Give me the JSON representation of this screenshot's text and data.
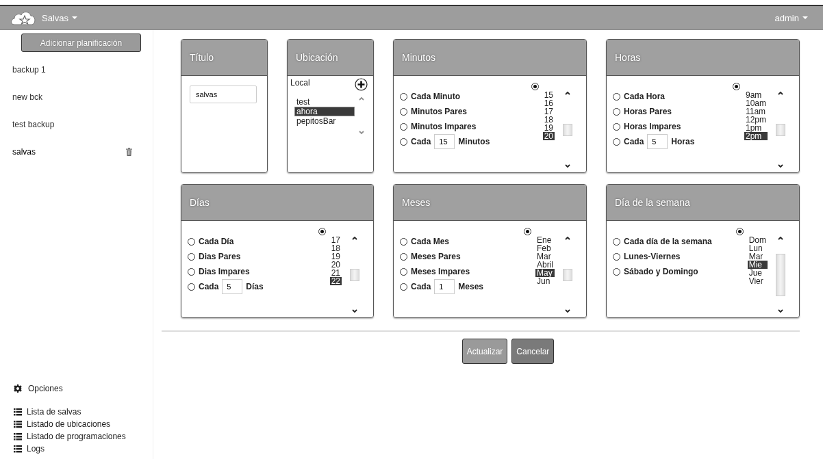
{
  "navbar": {
    "brand": "Salvas",
    "user": "admin"
  },
  "sidebar": {
    "add_button": "Adicionar planificación",
    "items": [
      {
        "label": "backup 1",
        "selected": false
      },
      {
        "label": "new bck",
        "selected": false
      },
      {
        "label": "test backup",
        "selected": false
      },
      {
        "label": "salvas",
        "selected": true
      }
    ],
    "options_title": "Opciones",
    "links": [
      "Lista de salvas",
      "Listado de ubicaciones",
      "Listado de programaciones",
      "Logs"
    ]
  },
  "title_card": {
    "title": "Título",
    "value": "salvas"
  },
  "location_card": {
    "title": "Ubicación",
    "type": "Local",
    "items": [
      {
        "label": "test",
        "selected": false
      },
      {
        "label": "ahora",
        "selected": true
      },
      {
        "label": "pepitosBar",
        "selected": false
      }
    ]
  },
  "schedule_cards": [
    {
      "title": "Minutos",
      "options": [
        {
          "label": "Cada Minuto",
          "selected": false
        },
        {
          "label": "Minutos Pares",
          "selected": false
        },
        {
          "label": "Minutos Impares",
          "selected": false
        }
      ],
      "every": {
        "prefix": "Cada",
        "value": "15",
        "suffix": "Minutos",
        "selected": false
      },
      "list": {
        "selected": true,
        "items": [
          {
            "label": "15",
            "selected": false
          },
          {
            "label": "16",
            "selected": false
          },
          {
            "label": "17",
            "selected": false
          },
          {
            "label": "18",
            "selected": false
          },
          {
            "label": "19",
            "selected": false
          },
          {
            "label": "20",
            "selected": true
          }
        ]
      }
    },
    {
      "title": "Horas",
      "options": [
        {
          "label": "Cada Hora",
          "selected": false
        },
        {
          "label": "Horas Pares",
          "selected": false
        },
        {
          "label": "Horas Impares",
          "selected": false
        }
      ],
      "every": {
        "prefix": "Cada",
        "value": "5",
        "suffix": "Horas",
        "selected": false
      },
      "list": {
        "selected": true,
        "items": [
          {
            "label": "9am",
            "selected": false
          },
          {
            "label": "10am",
            "selected": false
          },
          {
            "label": "11am",
            "selected": false
          },
          {
            "label": "12pm",
            "selected": false
          },
          {
            "label": "1pm",
            "selected": false
          },
          {
            "label": "2pm",
            "selected": true
          }
        ]
      }
    },
    {
      "title": "Días",
      "options": [
        {
          "label": "Cada Día",
          "selected": false
        },
        {
          "label": "Dias Pares",
          "selected": false
        },
        {
          "label": "Dias Impares",
          "selected": false
        }
      ],
      "every": {
        "prefix": "Cada",
        "value": "5",
        "suffix": "Días",
        "selected": false
      },
      "list": {
        "selected": true,
        "items": [
          {
            "label": "17",
            "selected": false
          },
          {
            "label": "18",
            "selected": false
          },
          {
            "label": "19",
            "selected": false
          },
          {
            "label": "20",
            "selected": false
          },
          {
            "label": "21",
            "selected": false
          },
          {
            "label": "22",
            "selected": true
          }
        ]
      }
    },
    {
      "title": "Meses",
      "options": [
        {
          "label": "Cada Mes",
          "selected": false
        },
        {
          "label": "Meses Pares",
          "selected": false
        },
        {
          "label": "Meses Impares",
          "selected": false
        }
      ],
      "every": {
        "prefix": "Cada",
        "value": "1",
        "suffix": "Meses",
        "selected": false
      },
      "list": {
        "selected": true,
        "items": [
          {
            "label": "Ene",
            "selected": false
          },
          {
            "label": "Feb",
            "selected": false
          },
          {
            "label": "Mar",
            "selected": false
          },
          {
            "label": "Abril",
            "selected": false
          },
          {
            "label": "May",
            "selected": true
          },
          {
            "label": "Jun",
            "selected": false
          }
        ]
      }
    },
    {
      "title": "Día de la semana",
      "options": [
        {
          "label": "Cada día de la semana",
          "selected": false
        },
        {
          "label": "Lunes-Viernes",
          "selected": false
        },
        {
          "label": "Sábado y Domingo",
          "selected": false
        }
      ],
      "list": {
        "selected": true,
        "items": [
          {
            "label": "Dom",
            "selected": false
          },
          {
            "label": "Lun",
            "selected": false
          },
          {
            "label": "Mar",
            "selected": false
          },
          {
            "label": "Mie",
            "selected": true
          },
          {
            "label": "Jue",
            "selected": false
          },
          {
            "label": "Vier",
            "selected": false
          }
        ]
      }
    }
  ],
  "buttons": [
    {
      "label": "Actualizar",
      "kind": "primary"
    },
    {
      "label": "Cancelar",
      "kind": "secondary"
    }
  ]
}
